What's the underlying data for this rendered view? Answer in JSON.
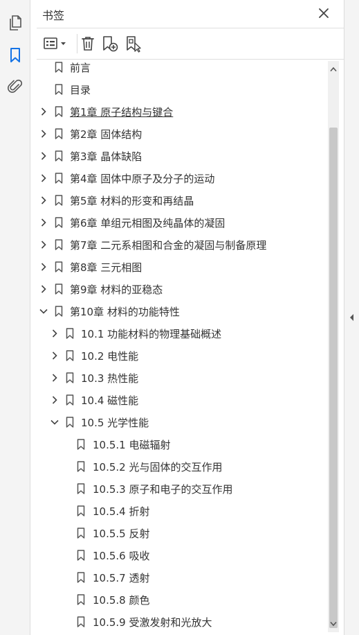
{
  "panel": {
    "title": "书签"
  },
  "icons": {
    "rail": [
      "pages-icon",
      "bookmark-icon",
      "attachment-icon"
    ],
    "toolbar": [
      "options-menu-icon",
      "delete-icon",
      "new-bookmark-icon",
      "bookmark-from-selection-icon"
    ],
    "accent": "#1473e6"
  },
  "bookmarks": [
    {
      "label": "前言",
      "level": 0,
      "expander": "none"
    },
    {
      "label": "目录",
      "level": 0,
      "expander": "none"
    },
    {
      "label": "第1章  原子结构与键合",
      "level": 0,
      "expander": "collapsed",
      "underline": true
    },
    {
      "label": "第2章  固体结构",
      "level": 0,
      "expander": "collapsed"
    },
    {
      "label": "第3章  晶体缺陷",
      "level": 0,
      "expander": "collapsed"
    },
    {
      "label": "第4章  固体中原子及分子的运动",
      "level": 0,
      "expander": "collapsed"
    },
    {
      "label": "第5章  材料的形变和再结晶",
      "level": 0,
      "expander": "collapsed"
    },
    {
      "label": "第6章  单组元相图及纯晶体的凝固",
      "level": 0,
      "expander": "collapsed"
    },
    {
      "label": "第7章  二元系相图和合金的凝固与制备原理",
      "level": 0,
      "expander": "collapsed"
    },
    {
      "label": "第8章  三元相图",
      "level": 0,
      "expander": "collapsed"
    },
    {
      "label": "第9章  材料的亚稳态",
      "level": 0,
      "expander": "collapsed"
    },
    {
      "label": "第10章  材料的功能特性",
      "level": 0,
      "expander": "expanded"
    },
    {
      "label": "10.1  功能材料的物理基础概述",
      "level": 1,
      "expander": "collapsed"
    },
    {
      "label": "10.2  电性能",
      "level": 1,
      "expander": "collapsed"
    },
    {
      "label": "10.3  热性能",
      "level": 1,
      "expander": "collapsed"
    },
    {
      "label": "10.4  磁性能",
      "level": 1,
      "expander": "collapsed"
    },
    {
      "label": "10.5  光学性能",
      "level": 1,
      "expander": "expanded"
    },
    {
      "label": "10.5.1  电磁辐射",
      "level": 2,
      "expander": "none"
    },
    {
      "label": "10.5.2  光与固体的交互作用",
      "level": 2,
      "expander": "none"
    },
    {
      "label": "10.5.3  原子和电子的交互作用",
      "level": 2,
      "expander": "none"
    },
    {
      "label": "10.5.4  折射",
      "level": 2,
      "expander": "none"
    },
    {
      "label": "10.5.5  反射",
      "level": 2,
      "expander": "none"
    },
    {
      "label": "10.5.6  吸收",
      "level": 2,
      "expander": "none"
    },
    {
      "label": "10.5.7  透射",
      "level": 2,
      "expander": "none"
    },
    {
      "label": "10.5.8  颜色",
      "level": 2,
      "expander": "none"
    },
    {
      "label": "10.5.9  受激发射和光放大",
      "level": 2,
      "expander": "none"
    }
  ]
}
